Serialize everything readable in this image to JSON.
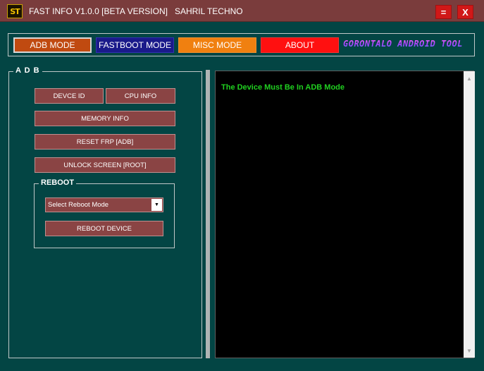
{
  "titlebar": {
    "logo": "ST",
    "title": "FAST INFO V1.0.0 [BETA VERSION]   SAHRIL TECHNO",
    "minimize_label": "=",
    "close_label": "X"
  },
  "topnav": {
    "adb_mode": "ADB MODE",
    "fastboot_mode": "FASTBOOT  MODE",
    "misc_mode": "MISC MODE",
    "about": "ABOUT",
    "brand": "GORONTALO ANDROID TOOL"
  },
  "adb": {
    "legend": "A D B",
    "device_id": "DEVCE ID",
    "cpu_info": "CPU INFO",
    "memory_info": "MEMORY INFO",
    "reset_frp": "RESET FRP [ADB]",
    "unlock_screen": "UNLOCK SCREEN  [ROOT]",
    "reboot": {
      "legend": "REBOOT",
      "select_value": "Select Reboot Mode",
      "reboot_device": "REBOOT DEVICE"
    }
  },
  "console": {
    "message": "The Device Must Be In ADB Mode"
  },
  "colors": {
    "background": "#034544",
    "titlebar": "#7a3c3c",
    "action_button": "#8a4444",
    "adb_nav": "#c04a10",
    "fastboot_nav": "#1a1a8a",
    "misc_nav": "#f08010",
    "about_nav": "#ff1010",
    "console_text": "#20d020"
  }
}
